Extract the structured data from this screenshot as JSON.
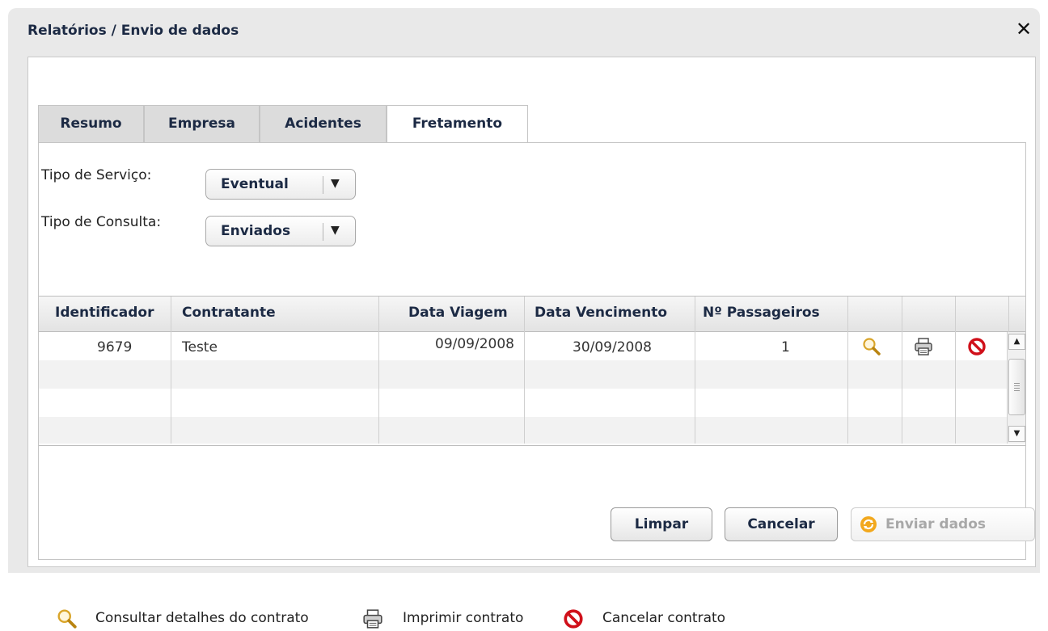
{
  "dialog": {
    "title": "Relatórios / Envio de dados",
    "close_symbol": "✕"
  },
  "tabs": [
    {
      "label": "Resumo",
      "active": false
    },
    {
      "label": "Empresa",
      "active": false
    },
    {
      "label": "Acidentes",
      "active": false
    },
    {
      "label": "Fretamento",
      "active": true
    }
  ],
  "form": {
    "tipo_servico": {
      "label": "Tipo de Serviço:",
      "value": "Eventual"
    },
    "tipo_consulta": {
      "label": "Tipo de Consulta:",
      "value": "Enviados"
    }
  },
  "grid": {
    "columns": [
      "Identificador",
      "Contratante",
      "Data Viagem",
      "Data Vencimento",
      "Nº Passageiros"
    ],
    "rows": [
      {
        "identificador": "9679",
        "contratante": "Teste",
        "data_viagem": "09/09/2008",
        "data_vencimento": "30/09/2008",
        "passageiros": "1"
      }
    ],
    "row_actions": [
      "magnifier-icon",
      "printer-icon",
      "cancel-icon"
    ]
  },
  "buttons": {
    "limpar": "Limpar",
    "cancelar": "Cancelar",
    "enviar": "Enviar dados"
  },
  "legend": {
    "consultar": "Consultar detalhes do contrato",
    "imprimir": "Imprimir contrato",
    "cancelar": "Cancelar contrato"
  },
  "colors": {
    "title": "#1c2a44",
    "cancel_icon": "#d0101a",
    "magnifier": "#d9a52a",
    "enviar_icon": "#f2a81d"
  }
}
